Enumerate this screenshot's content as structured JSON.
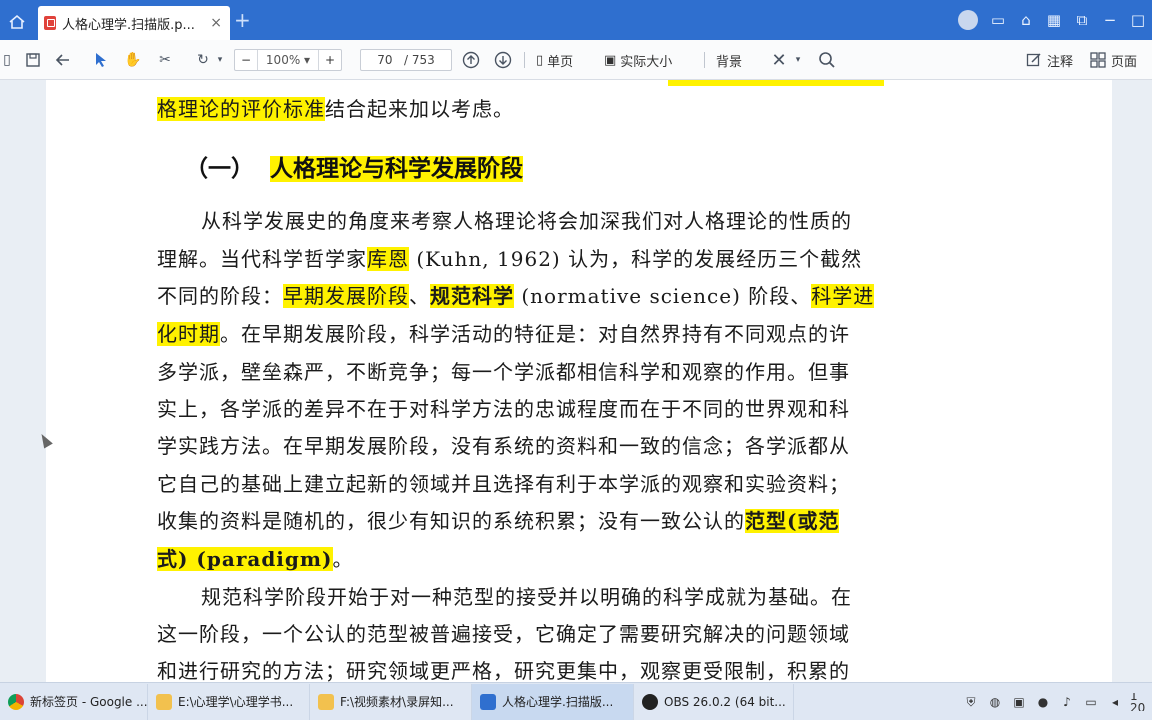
{
  "tab": {
    "title": "人格心理学.扫描版.p...",
    "close": "×",
    "new": "+"
  },
  "toolbar": {
    "zoom_minus": "−",
    "zoom_value": "100%",
    "zoom_plus": "+",
    "page_current": "70",
    "page_total": "/ 753",
    "single_page": "单页",
    "actual_size": "实际大小",
    "background": "背景",
    "annotate": "注释",
    "page_view": "页面"
  },
  "document": {
    "line_top": "格理论的评价标准结合起来加以考虑。",
    "line_top_hl": "格理论的评价标准",
    "line_top_rest": "结合起来加以考虑。",
    "heading_num": "（一）",
    "heading_text": "人格理论与科学发展阶段",
    "p1": {
      "l1": "从科学发展史的角度来考察人格理论将会加深我们对人格理论的性质的",
      "l2_a": "理解。当代科学哲学家",
      "l2_hl": "库恩",
      "l2_b": "(Kuhn, 1962) 认为，科学的发展经历三个截然",
      "l3_a": "不同的阶段：",
      "l3_hl1": "早期发展阶段",
      "l3_b": "、",
      "l3_hl2": "规范科学",
      "l3_c": "(normative science) 阶段、",
      "l3_hl3": "科学进",
      "l4_hl": "化时期",
      "l4_b": "。在早期发展阶段，科学活动的特征是：对自然界持有不同观点的许",
      "l5": "多学派，壁垒森严，不断竞争；每一个学派都相信科学和观察的作用。但事",
      "l6": "实上，各学派的差异不在于对科学方法的忠诚程度而在于不同的世界观和科",
      "l7": "学实践方法。在早期发展阶段，没有系统的资料和一致的信念；各学派都从",
      "l8": "它自己的基础上建立起新的领域并且选择有利于本学派的观察和实验资料；",
      "l9_a": "收集的资料是随机的，很少有知识的系统积累；没有一致公认的",
      "l9_hl": "范型(或范",
      "l10_hl": "式) (paradigm)",
      "l10_b": "。"
    },
    "p2": {
      "l1": "规范科学阶段开始于对一种范型的接受并以明确的科学成就为基础。在",
      "l2": "这一阶段，一个公认的范型被普遍接受，它确定了需要研究解决的问题领域",
      "l3": "和进行研究的方法；研究领域更严格，研究更集中，观察更受限制，积累的"
    }
  },
  "taskbar": {
    "items": [
      "新标签页 - Google ...",
      "E:\\心理学\\心理学书...",
      "F:\\视频素材\\录屏知...",
      "人格心理学.扫描版...",
      "OBS 26.0.2 (64 bit..."
    ],
    "clock": "1 20"
  },
  "colors": {
    "accent": "#2f6fcf",
    "highlight": "#fff200"
  }
}
